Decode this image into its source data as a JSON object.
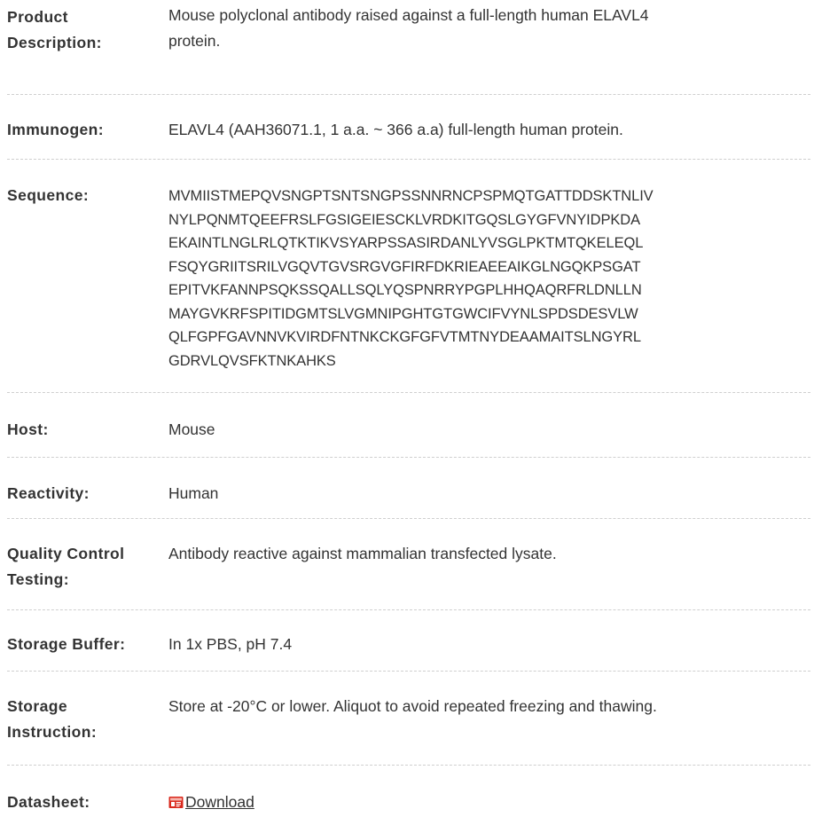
{
  "spec": {
    "product_description": {
      "label_line1": "Product",
      "label_line2": "Description:",
      "value_line1": "Mouse polyclonal antibody raised against a full-length human ELAVL4",
      "value_line2": "protein."
    },
    "immunogen": {
      "label": "Immunogen:",
      "value": "ELAVL4 (AAH36071.1, 1 a.a. ~ 366 a.a) full-length human protein."
    },
    "sequence": {
      "label": "Sequence:",
      "lines": [
        "MVMIISTMEPQVSNGPTSNTSNGPSSNNRNCPSPMQTGATTDDSKTNLIV",
        "NYLPQNMTQEEFRSLFGSIGEIESCKLVRDKITGQSLGYGFVNYIDPKDA",
        "EKAINTLNGLRLQTKTIKVSYARPSSASIRDANLYVSGLPKTMTQKELEQL",
        "FSQYGRIITSRILVGQVTGVSRGVGFIRFDKRIEAEEAIKGLNGQKPSGAT",
        "EPITVKFANNPSQKSSQALLSQLYQSPNRRYPGPLHHQAQRFRLDNLLN",
        "MAYGVKRFSPITIDGMTSLVGMNIPGHTGTGWCIFVYNLSPDSDESVLW",
        "QLFGPFGAVNNVKVIRDFNTNKCKGFGFVTMTNYDEAAMAITSLNGYRL",
        "GDRVLQVSFKTNKAHKS"
      ]
    },
    "host": {
      "label": "Host:",
      "value": "Mouse"
    },
    "reactivity": {
      "label": "Reactivity:",
      "value": "Human"
    },
    "quality_control": {
      "label_line1": "Quality Control",
      "label_line2": "Testing:",
      "value": "Antibody reactive against mammalian transfected lysate."
    },
    "storage_buffer": {
      "label": "Storage Buffer:",
      "value": "In 1x PBS, pH 7.4"
    },
    "storage_instruction": {
      "label_line1": "Storage",
      "label_line2": "Instruction:",
      "value": "Store at -20°C or lower. Aliquot to avoid repeated freezing and thawing."
    },
    "datasheet": {
      "label": "Datasheet:",
      "link_text": "Download",
      "icon": "pdf-file-icon"
    }
  },
  "colors": {
    "text": "#333333",
    "divider": "#cfcfcf",
    "pdf_red": "#d9281c"
  }
}
